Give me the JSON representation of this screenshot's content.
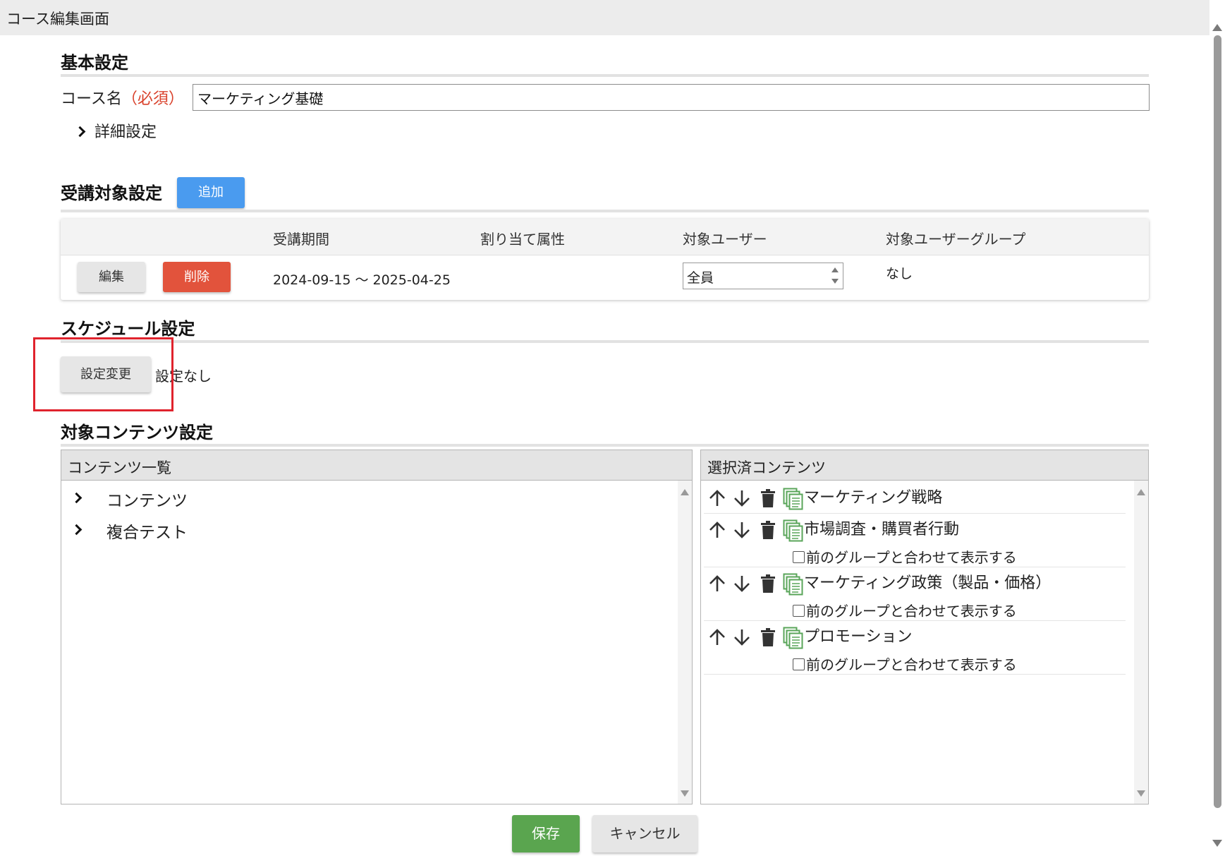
{
  "window": {
    "title": "コース編集画面"
  },
  "basic": {
    "heading": "基本設定",
    "course_name_label": "コース名",
    "required_label": "（必須）",
    "course_name_value": "マーケティング基礎",
    "detail_toggle": "詳細設定"
  },
  "target": {
    "heading": "受講対象設定",
    "add_label": "追加",
    "columns": [
      "受講期間",
      "割り当て属性",
      "対象ユーザー",
      "対象ユーザーグループ"
    ],
    "row": {
      "edit_label": "編集",
      "delete_label": "削除",
      "period": "2024-09-15 ～ 2025-04-25",
      "attribute": "",
      "users": "全員",
      "groups": "なし"
    }
  },
  "schedule": {
    "heading": "スケジュール設定",
    "change_label": "設定変更",
    "status": "設定なし"
  },
  "contents": {
    "heading": "対象コンテンツ設定",
    "list_title": "コンテンツ一覧",
    "list_items": [
      "コンテンツ",
      "複合テスト"
    ],
    "selected_title": "選択済コンテンツ",
    "merge_label": "前のグループと合わせて表示する",
    "selected_items": [
      {
        "name": "マーケティング戦略",
        "has_checkbox": false,
        "checked": false
      },
      {
        "name": "市場調査・購買者行動",
        "has_checkbox": true,
        "checked": false
      },
      {
        "name": "マーケティング政策（製品・価格）",
        "has_checkbox": true,
        "checked": false
      },
      {
        "name": "プロモーション",
        "has_checkbox": true,
        "checked": false
      }
    ]
  },
  "footer": {
    "save_label": "保存",
    "cancel_label": "キャンセル"
  },
  "colors": {
    "primary": "#4a9bef",
    "danger": "#e2533c",
    "success": "#5aa54f",
    "highlight": "#e0232d",
    "content_icon": "#5aa55a",
    "required": "#d9412b"
  },
  "icons": {
    "move_up": "arrow-up-icon",
    "move_down": "arrow-down-icon",
    "delete": "trash-icon",
    "content": "content-pages-icon",
    "expand": "chevron-right-icon"
  }
}
